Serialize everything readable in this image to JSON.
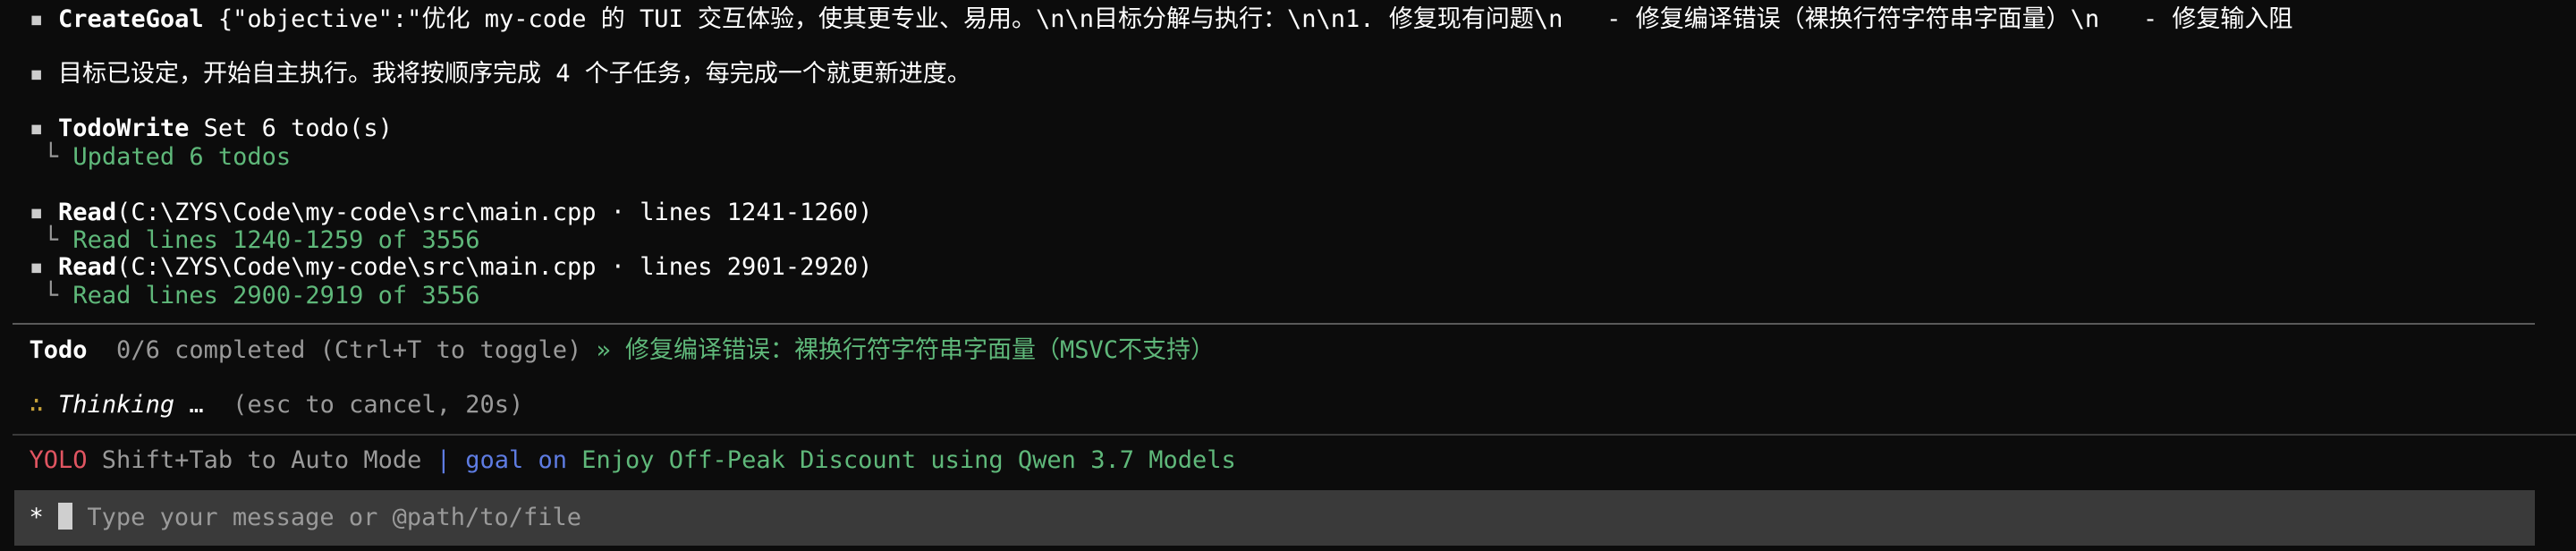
{
  "messages": [
    {
      "tool": "CreateGoal",
      "args": " {\"objective\":\"优化 my-code 的 TUI 交互体验，使其更专业、易用。\\n\\n目标分解与执行：\\n\\n1. 修复现有问题\\n   - 修复编译错误（裸换行符字符串字面量）\\n   - 修复输入阻"
    },
    {
      "text": "目标已设定，开始自主执行。我将按顺序完成 4 个子任务，每完成一个就更新进度。"
    },
    {
      "tool": "TodoWrite",
      "args": " Set 6 todo(s)",
      "result": "Updated 6 todos"
    },
    {
      "tool": "Read",
      "args": "(C:\\ZYS\\Code\\my-code\\src\\main.cpp · lines 1241-1260)",
      "result": "Read lines 1240-1259 of 3556"
    },
    {
      "tool": "Read",
      "args": "(C:\\ZYS\\Code\\my-code\\src\\main.cpp · lines 2901-2920)",
      "result": "Read lines 2900-2919 of 3556"
    }
  ],
  "todo": {
    "label": "Todo",
    "status": "  0/6 completed (Ctrl+T to toggle) ",
    "current": "» 修复编译错误：裸换行符字符串字面量（MSVC不支持）"
  },
  "thinking": {
    "icon": "∴",
    "label": "Thinking",
    "dots": " …",
    "hint": "  (esc to cancel, 20s)"
  },
  "statusbar": {
    "mode": "YOLO",
    "hint": " Shift+Tab to Auto Mode ",
    "sep": "|",
    "goal": " goal on",
    "promo": " Enjoy Off-Peak Discount using Qwen 3.7 Models"
  },
  "input": {
    "prompt": "*",
    "placeholder": "Type your message or @path/to/file"
  },
  "colors": {
    "background": "#0c0c0c",
    "green": "#5fb87a",
    "yolo": "#e05561",
    "goal": "#5e7ce2"
  }
}
